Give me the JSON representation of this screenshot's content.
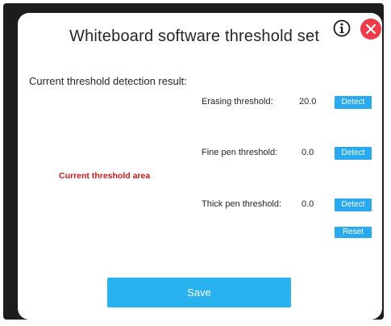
{
  "dialog": {
    "title": "Whiteboard software threshold set"
  },
  "icons": {
    "info": "info-icon",
    "close": "close-icon",
    "close_color": "#ee3b4a"
  },
  "detection": {
    "section_label": "Current threshold detection result:",
    "area_label": "Current threshold area",
    "rows": [
      {
        "label": "Erasing threshold:",
        "value": "20.0",
        "button": "Detect"
      },
      {
        "label": "Fine pen threshold:",
        "value": "0.0",
        "button": "Detect"
      },
      {
        "label": "Thick pen threshold:",
        "value": "0.0",
        "button": "Detect"
      }
    ],
    "reset_label": "Reset"
  },
  "footer": {
    "save_label": "Save"
  },
  "colors": {
    "accent": "#29a9ee",
    "area_label": "#c81818",
    "frame": "#1c1c1c"
  }
}
